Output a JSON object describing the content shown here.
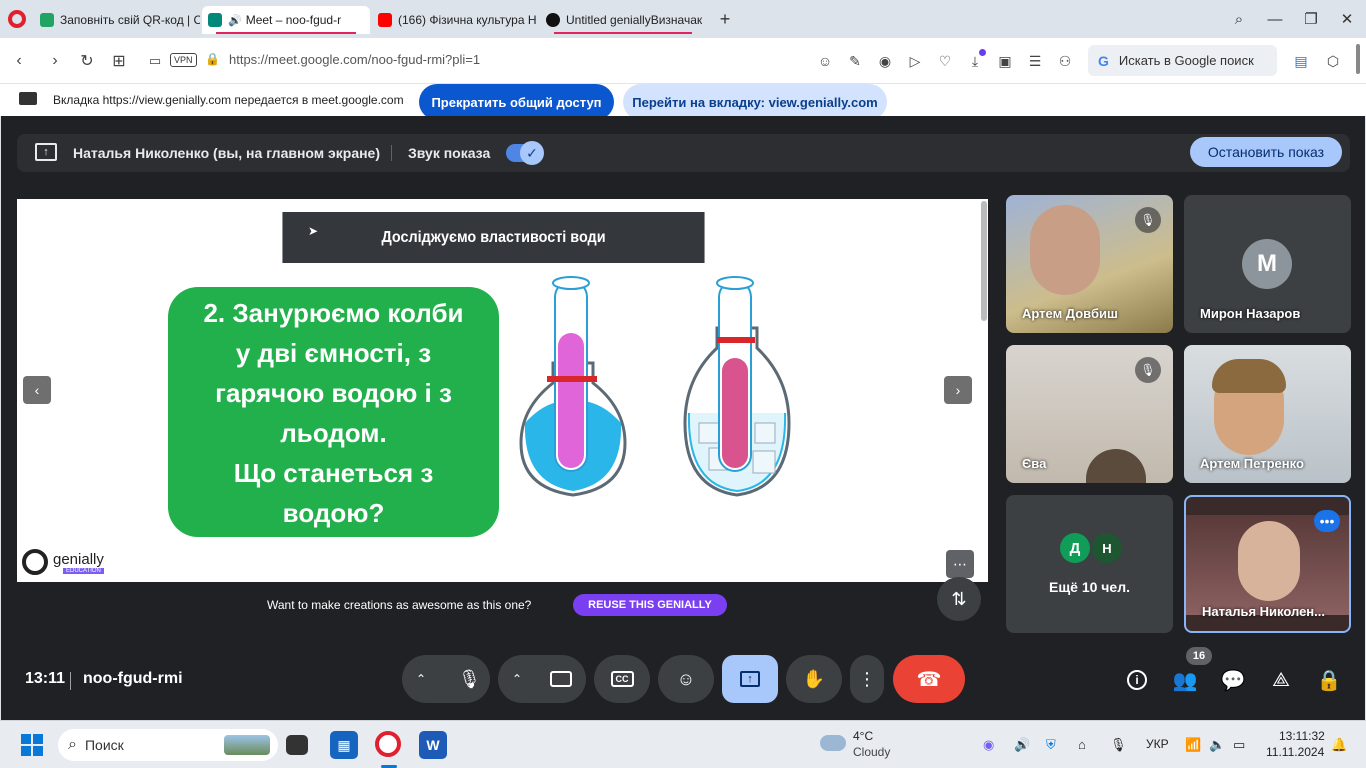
{
  "browser": {
    "tabs": [
      {
        "label": "Заповніть свій QR-код | С",
        "color": "#1fa463"
      },
      {
        "label": "Meet – noo-fgud-r",
        "color": "#00897b"
      },
      {
        "label": "(166) Фізична культура Н",
        "color": "#ff0000"
      },
      {
        "label": "Untitled geniallyВизначак",
        "color": "#111111"
      }
    ],
    "new_tab": "+",
    "url": "https://meet.google.com/noo-fgud-rmi?pli=1",
    "vpn": "VPN",
    "search_label": "Искать в Google поиск",
    "share_message": "Вкладка https://view.genially.com передается в meet.google.com",
    "stop_sharing": "Прекратить общий доступ",
    "go_to_tab": "Перейти на вкладку: view.genially.com"
  },
  "presenting": {
    "label": "Наталья Николенко (вы, на главном экране)",
    "sound_label": "Звук показа",
    "stop_button": "Остановить показ"
  },
  "slide": {
    "title": "Досліджуємо властивості води",
    "text_lines": [
      "2. Занурюємо колби",
      "у дві ємності, з",
      "гарячою водою і з",
      "льодом.",
      "Що станеться з",
      "водою?"
    ],
    "logo": "genially",
    "logo_sub": "EDUCATION",
    "promo_text": "Want to make creations as awesome as this one?",
    "reuse_button": "REUSE THIS GENIALLY"
  },
  "participants": [
    {
      "name": "Артем Довбиш",
      "muted": true
    },
    {
      "name": "Мирон Назаров",
      "initial": "M"
    },
    {
      "name": "Єва",
      "muted": true
    },
    {
      "name": "Артем Петренко"
    },
    {
      "name": "Ещё 10 чел.",
      "initials": [
        "Д",
        "Н"
      ]
    },
    {
      "name": "Наталья Николен..."
    }
  ],
  "meeting": {
    "time": "13:11",
    "code": "noo-fgud-rmi",
    "people_count": "16"
  },
  "taskbar": {
    "search": "Поиск",
    "weather_temp": "4°C",
    "weather_desc": "Cloudy",
    "lang": "УКР",
    "time": "13:11:32",
    "date": "11.11.2024"
  },
  "colors": {
    "end_call": "#ea4335",
    "present_active": "#a8c7fa",
    "green_box": "#21b04b"
  }
}
